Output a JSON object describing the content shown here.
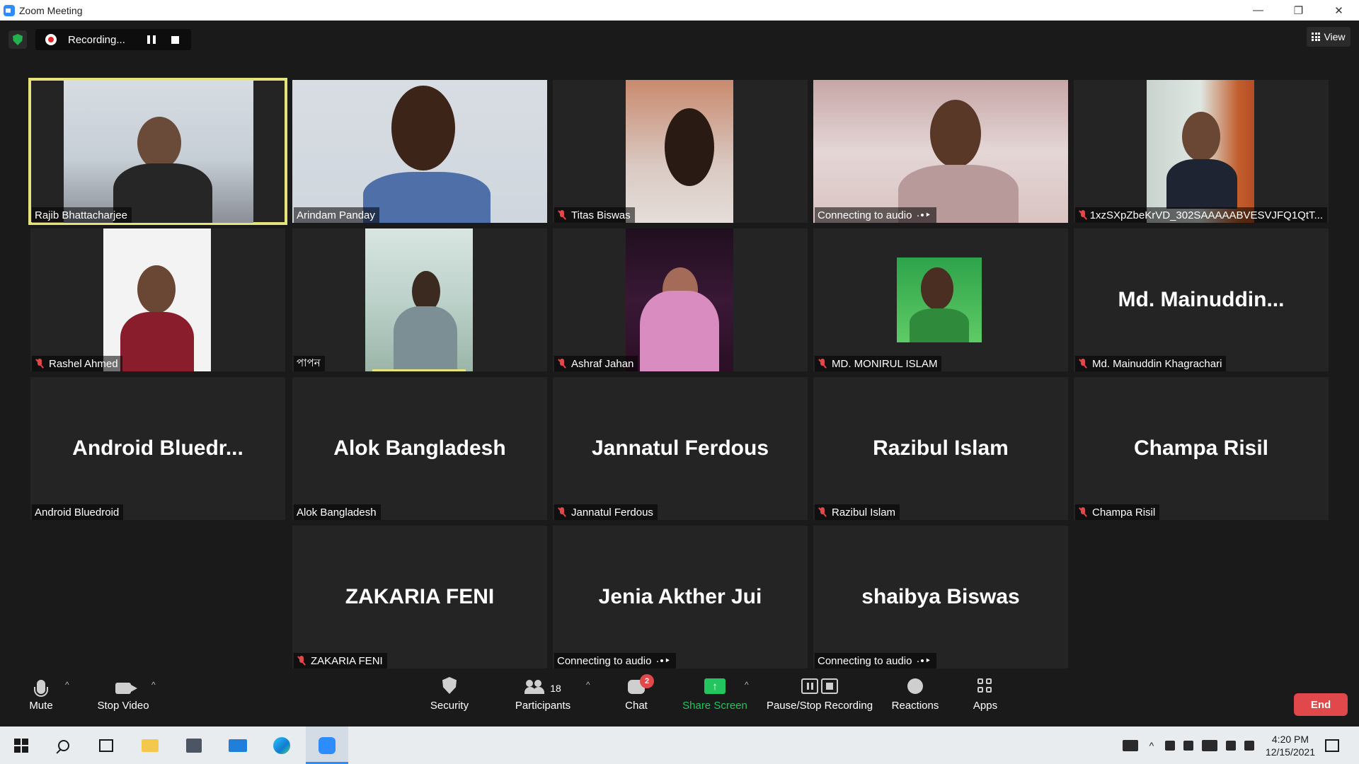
{
  "window": {
    "title": "Zoom Meeting"
  },
  "recording": {
    "status": "Recording..."
  },
  "view": {
    "label": "View"
  },
  "tiles": [
    {
      "name": "Rajib Bhattacharjee",
      "muted": false,
      "video": true,
      "active": true
    },
    {
      "name": "Arindam Panday",
      "muted": false,
      "video": true
    },
    {
      "name": "Titas Biswas",
      "muted": true,
      "video": true
    },
    {
      "name": "Connecting to audio",
      "muted": false,
      "video": true,
      "connecting": true
    },
    {
      "name": "1xzSXpZbeKrVD_302SAAAAABVESVJFQ1QtT...",
      "muted": true,
      "video": true
    },
    {
      "name": "Rashel Ahmed",
      "muted": true,
      "video": true
    },
    {
      "name": "পাপন",
      "muted": false,
      "video": true
    },
    {
      "name": "Ashraf Jahan",
      "muted": true,
      "video": true
    },
    {
      "name": "MD. MONIRUL ISLAM",
      "muted": true,
      "video": true
    },
    {
      "name": "Md. Mainuddin Khagrachari",
      "display": "Md.  Mainuddin...",
      "muted": true,
      "video": false
    },
    {
      "name": "Android Bluedroid",
      "display": "Android  Bluedr...",
      "muted": false,
      "video": false
    },
    {
      "name": "Alok Bangladesh",
      "display": "Alok Bangladesh",
      "muted": false,
      "video": false
    },
    {
      "name": "Jannatul Ferdous",
      "display": "Jannatul Ferdous",
      "muted": true,
      "video": false
    },
    {
      "name": "Razibul Islam",
      "display": "Razibul Islam",
      "muted": true,
      "video": false
    },
    {
      "name": "Champa Risil",
      "display": "Champa Risil",
      "muted": true,
      "video": false
    },
    {
      "name": "ZAKARIA FENI",
      "display": "ZAKARIA FENI",
      "muted": true,
      "video": false
    },
    {
      "name": "Connecting to audio",
      "display": "Jenia Akther Jui",
      "muted": false,
      "video": false,
      "connecting": true
    },
    {
      "name": "Connecting to audio",
      "display": "shaibya Biswas",
      "muted": false,
      "video": false,
      "connecting": true
    }
  ],
  "toolbar": {
    "mute": "Mute",
    "stop_video": "Stop Video",
    "security": "Security",
    "participants": "Participants",
    "participants_count": "18",
    "chat": "Chat",
    "chat_badge": "2",
    "share_screen": "Share Screen",
    "pause_stop_recording": "Pause/Stop Recording",
    "reactions": "Reactions",
    "apps": "Apps",
    "end": "End",
    "share_color": "#22c55e",
    "end_color": "#e0484b"
  },
  "taskbar": {
    "time": "4:20 PM",
    "date": "12/15/2021"
  }
}
